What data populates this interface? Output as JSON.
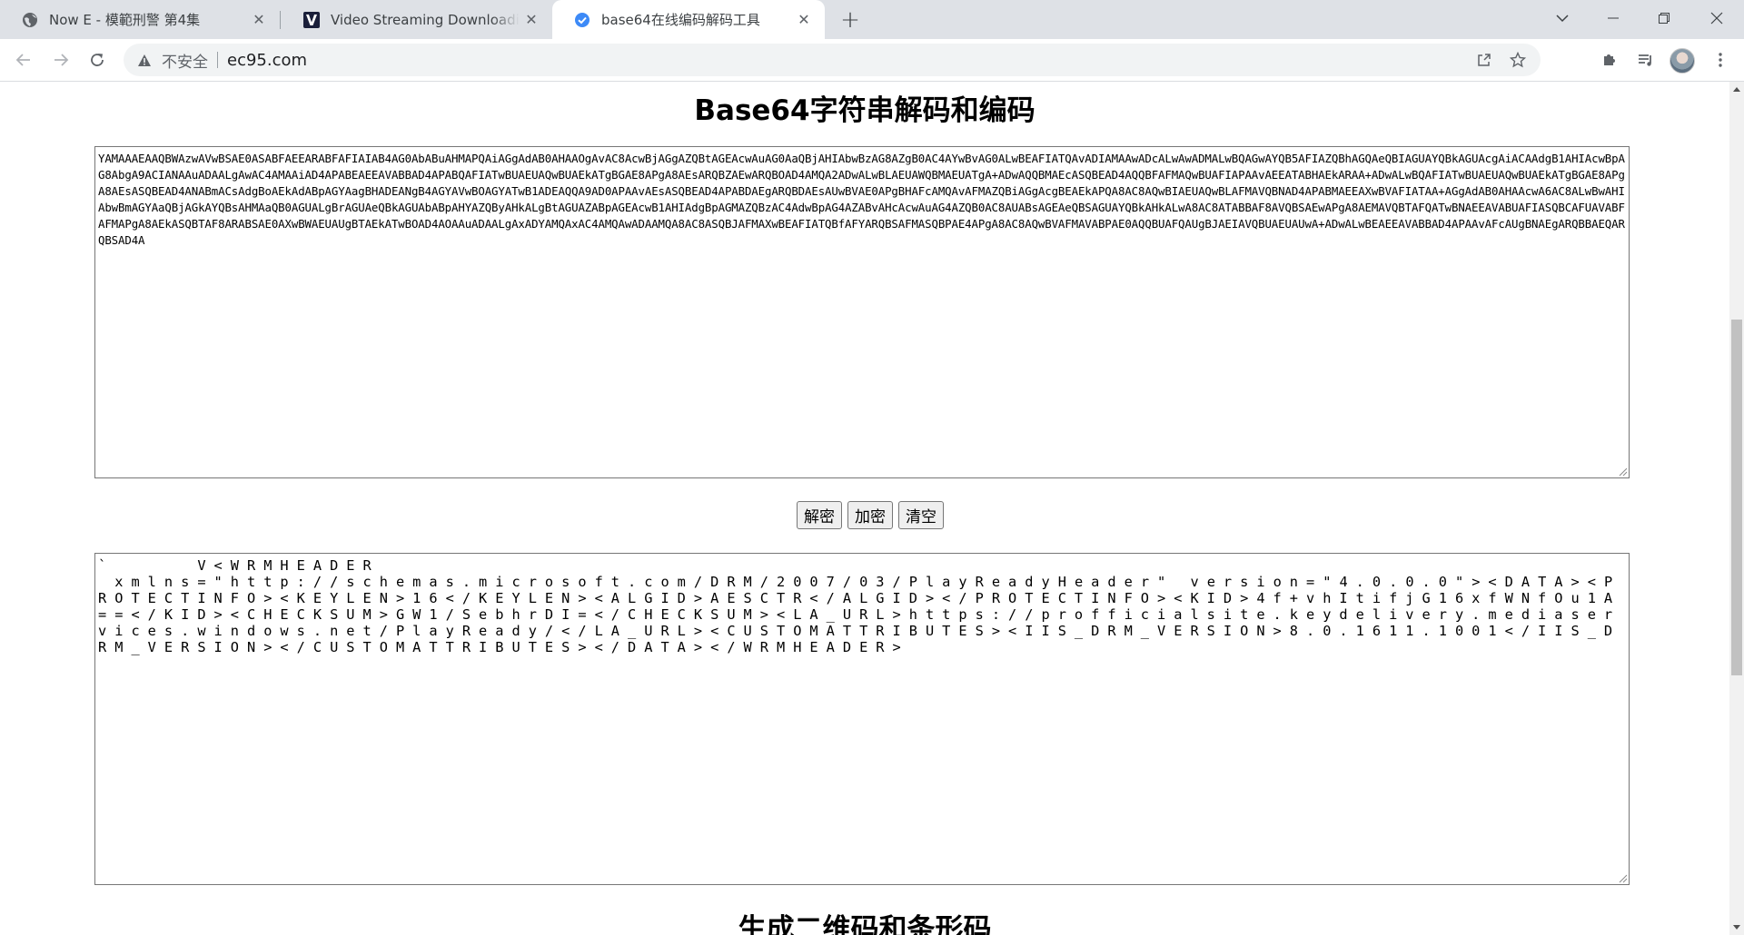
{
  "browser": {
    "tabs": [
      {
        "title": "Now E - 模範刑警 第4集",
        "favicon": "globe-icon"
      },
      {
        "title": "Video Streaming Downloading",
        "favicon": "v-logo-icon"
      },
      {
        "title": "base64在线编码解码工具",
        "favicon": "check-badge-icon",
        "active": true
      }
    ],
    "security_label": "不安全",
    "url": "ec95.com"
  },
  "page": {
    "heading": "Base64字符串解码和编码",
    "encoded_text": "YAMAAAEAAQBWAzwAVwBSAE0ASABFAEEARABFAFIAIAB4AG0AbABuAHMAPQAiAGgAdAB0AHAAOgAvAC8AcwBjAGgAZQBtAGEAcwAuAG0AaQBjAHIAbwBzAG8AZgB0AC4AYwBvAG0ALwBEAFIATQAvADIAMAAwADcALwAwADMALwBQAGwAYQB5AFIAZQBhAGQAeQBIAGUAYQBkAGUAcgAiACAAdgB1AHIAcwBpAG8AbgA9ACIANAAuADAALgAwAC4AMAAiAD4APABEAEEAVABBAD4APABQAFIATwBUAEUAQwBUAEkATgBGAE8APgA8AEsARQBZAEwARQBOAD4AMQA2ADwALwBLAEUAWQBMAEUATgA+ADwAQQBMAEcASQBEAD4AQQBFAFMAQwBUAFIAPAAvAEEATABHAEkARAA+ADwALwBQAFIATwBUAEUAQwBUAEkATgBGAE8APgA8AEsASQBEAD4ANABmACsAdgBoAEkAdABpAGYAagBHADEANgB4AGYAVwBOAGYATwB1ADEAQQA9AD0APAAvAEsASQBEAD4APABDAEgARQBDAEsAUwBVAE0APgBHAFcAMQAvAFMAZQBiAGgAcgBEAEkAPQA8AC8AQwBIAEUAQwBLAFMAVQBNAD4APABMAEEAXwBVAFIATAA+AGgAdAB0AHAAcwA6AC8ALwBwAHIAbwBmAGYAaQBjAGkAYQBsAHMAaQB0AGUALgBrAGUAeQBkAGUAbABpAHYAZQByAHkALgBtAGUAZABpAGEAcwB1AHIAdgBpAGMAZQBzAC4AdwBpAG4AZABvAHcAcwAuAG4AZQB0AC8AUABsAGEAeQBSAGUAYQBkAHkALwA8AC8ATABBAF8AVQBSAEwAPgA8AEMAVQBTAFQATwBNAEEAVABUAFIASQBCAFUAVABFAFMAPgA8AEkASQBTAF8ARABSAE0AXwBWAEUAUgBTAEkATwBOAD4AOAAuADAALgAxADYAMQAxAC4AMQAwADAAMQA8AC8ASQBJAFMAXwBEAFIATQBfAFYARQBSAFMASQBPAE4APgA8AC8AQwBVAFMAVABPAE0AQQBUAFQAUgBJAEIAVQBUAEUAUwA+ADwALwBEAEEAVABBAD4APAAvAFcAUgBNAEgARQBBAEQARQBSAD4A",
    "buttons": {
      "decode": "解密",
      "encode": "加密",
      "clear": "清空"
    },
    "decoded_text": "`           V < W R M H E A D E R\n  x m l n s = \" h t t p : / / s c h e m a s . m i c r o s o f t . c o m / D R M / 2 0 0 7 / 0 3 / P l a y R e a d y H e a d e r \"   v e r s i o n = \" 4 . 0 . 0 . 0 \" > < D A T A > < P R O T E C T I N F O > < K E Y L E N > 1 6 < / K E Y L E N > < A L G I D > A E S C T R < / A L G I D > < / P R O T E C T I N F O > < K I D > 4 f + v h I t i f j G 1 6 x f W N f O u 1 A = = < / K I D > < C H E C K S U M > G W 1 / S e b h r D I = < / C H E C K S U M > < L A _ U R L > h t t p s : / / p r o f f i c i a l s i t e . k e y d e l i v e r y . m e d i a s e r v i c e s . w i n d o w s . n e t / P l a y R e a d y / < / L A _ U R L > < C U S T O M A T T R I B U T E S > < I I S _ D R M _ V E R S I O N > 8 . 0 . 1 6 1 1 . 1 0 0 1 < / I I S _ D R M _ V E R S I O N > < / C U S T O M A T T R I B U T E S > < / D A T A > < / W R M H E A D E R >",
    "next_heading": "生成二维码和条形码"
  }
}
